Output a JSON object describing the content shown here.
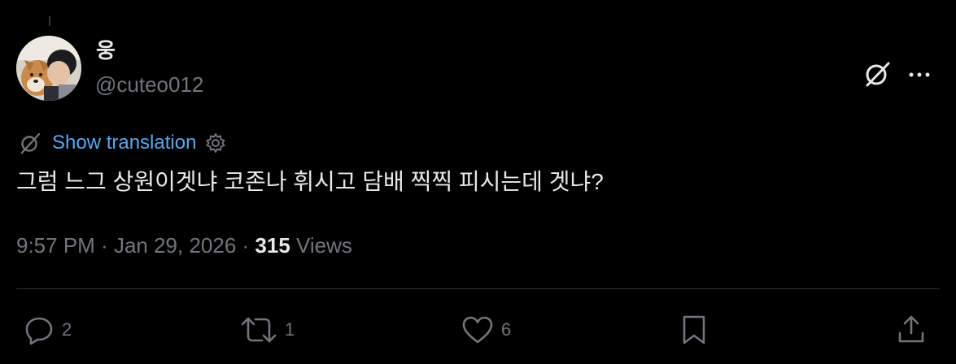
{
  "post": {
    "display_name": "웅",
    "handle": "@cuteo012",
    "translate_label": "Show translation",
    "text": "그럼 느그 상원이겟냐 코존나 휘시고 담배 찍찍 피시는데 겟냐?",
    "time": "9:57 PM",
    "separator1": " · ",
    "date": "Jan 29, 2026",
    "separator2": " · ",
    "views_count": "315",
    "views_label": " Views"
  },
  "actions": {
    "reply_count": "2",
    "repost_count": "1",
    "like_count": "6"
  },
  "icons": {
    "grok": "grok-icon",
    "more": "more-icon",
    "translate": "translate-icon",
    "settings": "gear-icon",
    "reply": "reply-icon",
    "repost": "repost-icon",
    "like": "heart-icon",
    "bookmark": "bookmark-icon",
    "share": "share-icon"
  },
  "colors": {
    "background": "#000000",
    "text": "#e7e9ea",
    "muted": "#71767b",
    "link": "#5aa6ee",
    "divider": "#2f3336"
  }
}
